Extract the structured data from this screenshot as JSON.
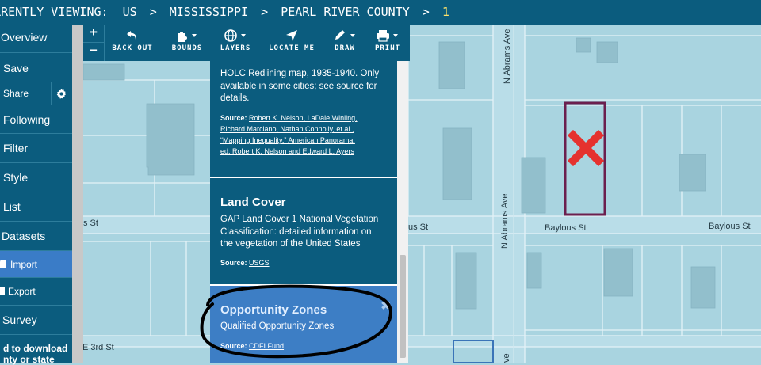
{
  "breadcrumb": {
    "prefix": "CURRENTLY VIEWING:",
    "items": [
      "US",
      "MISSISSIPPI",
      "PEARL RIVER COUNTY"
    ],
    "page": "1",
    "separator": ">"
  },
  "sidebar": {
    "items": [
      "Overview",
      "Save",
      "Share",
      "Following",
      "Filter",
      "Style",
      "List",
      "Datasets",
      "Import",
      "Export",
      "Survey"
    ],
    "footer_line1": "d to download",
    "footer_line2": "nty or state"
  },
  "toolbar": {
    "zoom_in": "+",
    "zoom_out": "−",
    "back_out": "BACK OUT",
    "bounds": "BOUNDS",
    "layers": "LAYERS",
    "locate_me": "LOCATE ME",
    "draw": "DRAW",
    "print": "PRINT"
  },
  "layers": [
    {
      "desc_lines": [
        "HOLC Redlining map, 1935-1940. Only",
        "available in some cities; see source for",
        "details."
      ],
      "source_label": "Source:",
      "source_lines": [
        "Robert K. Nelson, LaDale Winling,",
        "Richard Marciano, Nathan Connolly, et al.,",
        "“Mapping Inequality,” American Panorama,",
        "ed. Robert K. Nelson and Edward L. Ayers"
      ]
    },
    {
      "title": "Land Cover",
      "desc_lines": [
        "GAP Land Cover 1 National Vegetation",
        "Classification: detailed information on",
        "the vegetation of the United States"
      ],
      "source_label": "Source:",
      "source": "USGS"
    },
    {
      "title": "Opportunity Zones",
      "desc": "Qualified Opportunity Zones",
      "source_label": "Source:",
      "source": "CDFI Fund",
      "selected": true
    }
  ],
  "map": {
    "streets": {
      "abrams_top": "N Abrams Ave",
      "abrams_bottom": "N Abrams Ave",
      "abrams_bottom_cut": "ve",
      "baylous_left": "s St",
      "baylous_mid_left": "us St",
      "baylous_mid": "Baylous St",
      "baylous_right": "Baylous St",
      "third": "E 3rd St"
    },
    "marker_color": "#e5322f",
    "parcel_highlight_color": "#6b1f4e"
  },
  "colors": {
    "brand": "#0b5c7e",
    "selected": "#3d7ec5",
    "map_bg": "#a9d4e0"
  }
}
